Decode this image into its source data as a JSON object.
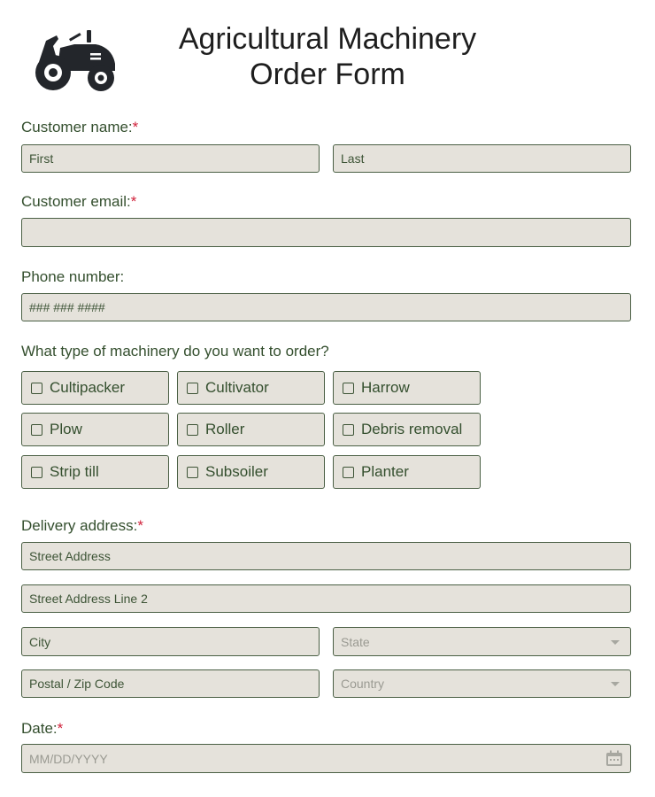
{
  "header": {
    "title_line1": "Agricultural Machinery",
    "title_line2": "Order Form",
    "logo_icon": "tractor-icon"
  },
  "colors": {
    "field_bg": "#e5e2db",
    "field_border": "#4a5f44",
    "label_text": "#344f2e",
    "required_asterisk": "#d0213a"
  },
  "customer_name": {
    "label": "Customer name:",
    "required": "*",
    "first_placeholder": "First",
    "last_placeholder": "Last"
  },
  "customer_email": {
    "label": "Customer email:",
    "required": "*",
    "value": ""
  },
  "phone": {
    "label": "Phone number:",
    "placeholder": "### ### ####"
  },
  "machinery": {
    "label": "What type of machinery do you want to order?",
    "options": [
      {
        "label": "Cultipacker",
        "checked": false
      },
      {
        "label": "Cultivator",
        "checked": false
      },
      {
        "label": "Harrow",
        "checked": false
      },
      {
        "label": "Plow",
        "checked": false
      },
      {
        "label": "Roller",
        "checked": false
      },
      {
        "label": "Debris removal",
        "checked": false
      },
      {
        "label": "Strip till",
        "checked": false
      },
      {
        "label": "Subsoiler",
        "checked": false
      },
      {
        "label": "Planter",
        "checked": false
      }
    ]
  },
  "delivery": {
    "label": "Delivery address:",
    "required": "*",
    "street_placeholder": "Street Address",
    "street2_placeholder": "Street Address Line 2",
    "city_placeholder": "City",
    "state_placeholder": "State",
    "zip_placeholder": "Postal / Zip Code",
    "country_placeholder": "Country"
  },
  "date": {
    "label": "Date:",
    "required": "*",
    "placeholder": "MM/DD/YYYY",
    "icon": "calendar-icon"
  }
}
